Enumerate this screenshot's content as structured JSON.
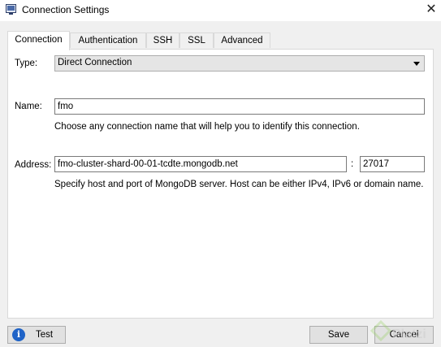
{
  "window": {
    "title": "Connection Settings",
    "title_icon": "window-app-icon",
    "close_icon": "close-icon",
    "close_glyph": "✕"
  },
  "tabs": [
    {
      "label": "Connection",
      "active": true
    },
    {
      "label": "Authentication",
      "active": false
    },
    {
      "label": "SSH",
      "active": false
    },
    {
      "label": "SSL",
      "active": false
    },
    {
      "label": "Advanced",
      "active": false
    }
  ],
  "connection": {
    "type_label": "Type:",
    "type_value": "Direct Connection",
    "name_label": "Name:",
    "name_value": "fmo",
    "name_hint": "Choose any connection name that will help you to identify this connection.",
    "address_label": "Address:",
    "host_value": "fmo-cluster-shard-00-01-tcdte.mongodb.net",
    "separator": ":",
    "port_value": "27017",
    "address_hint": "Specify host and port of MongoDB server. Host can be either IPv4, IPv6 or domain name."
  },
  "buttons": {
    "test": "Test",
    "save": "Save",
    "cancel": "Cancel"
  },
  "watermark_icon": "platzi-watermark-icon"
}
